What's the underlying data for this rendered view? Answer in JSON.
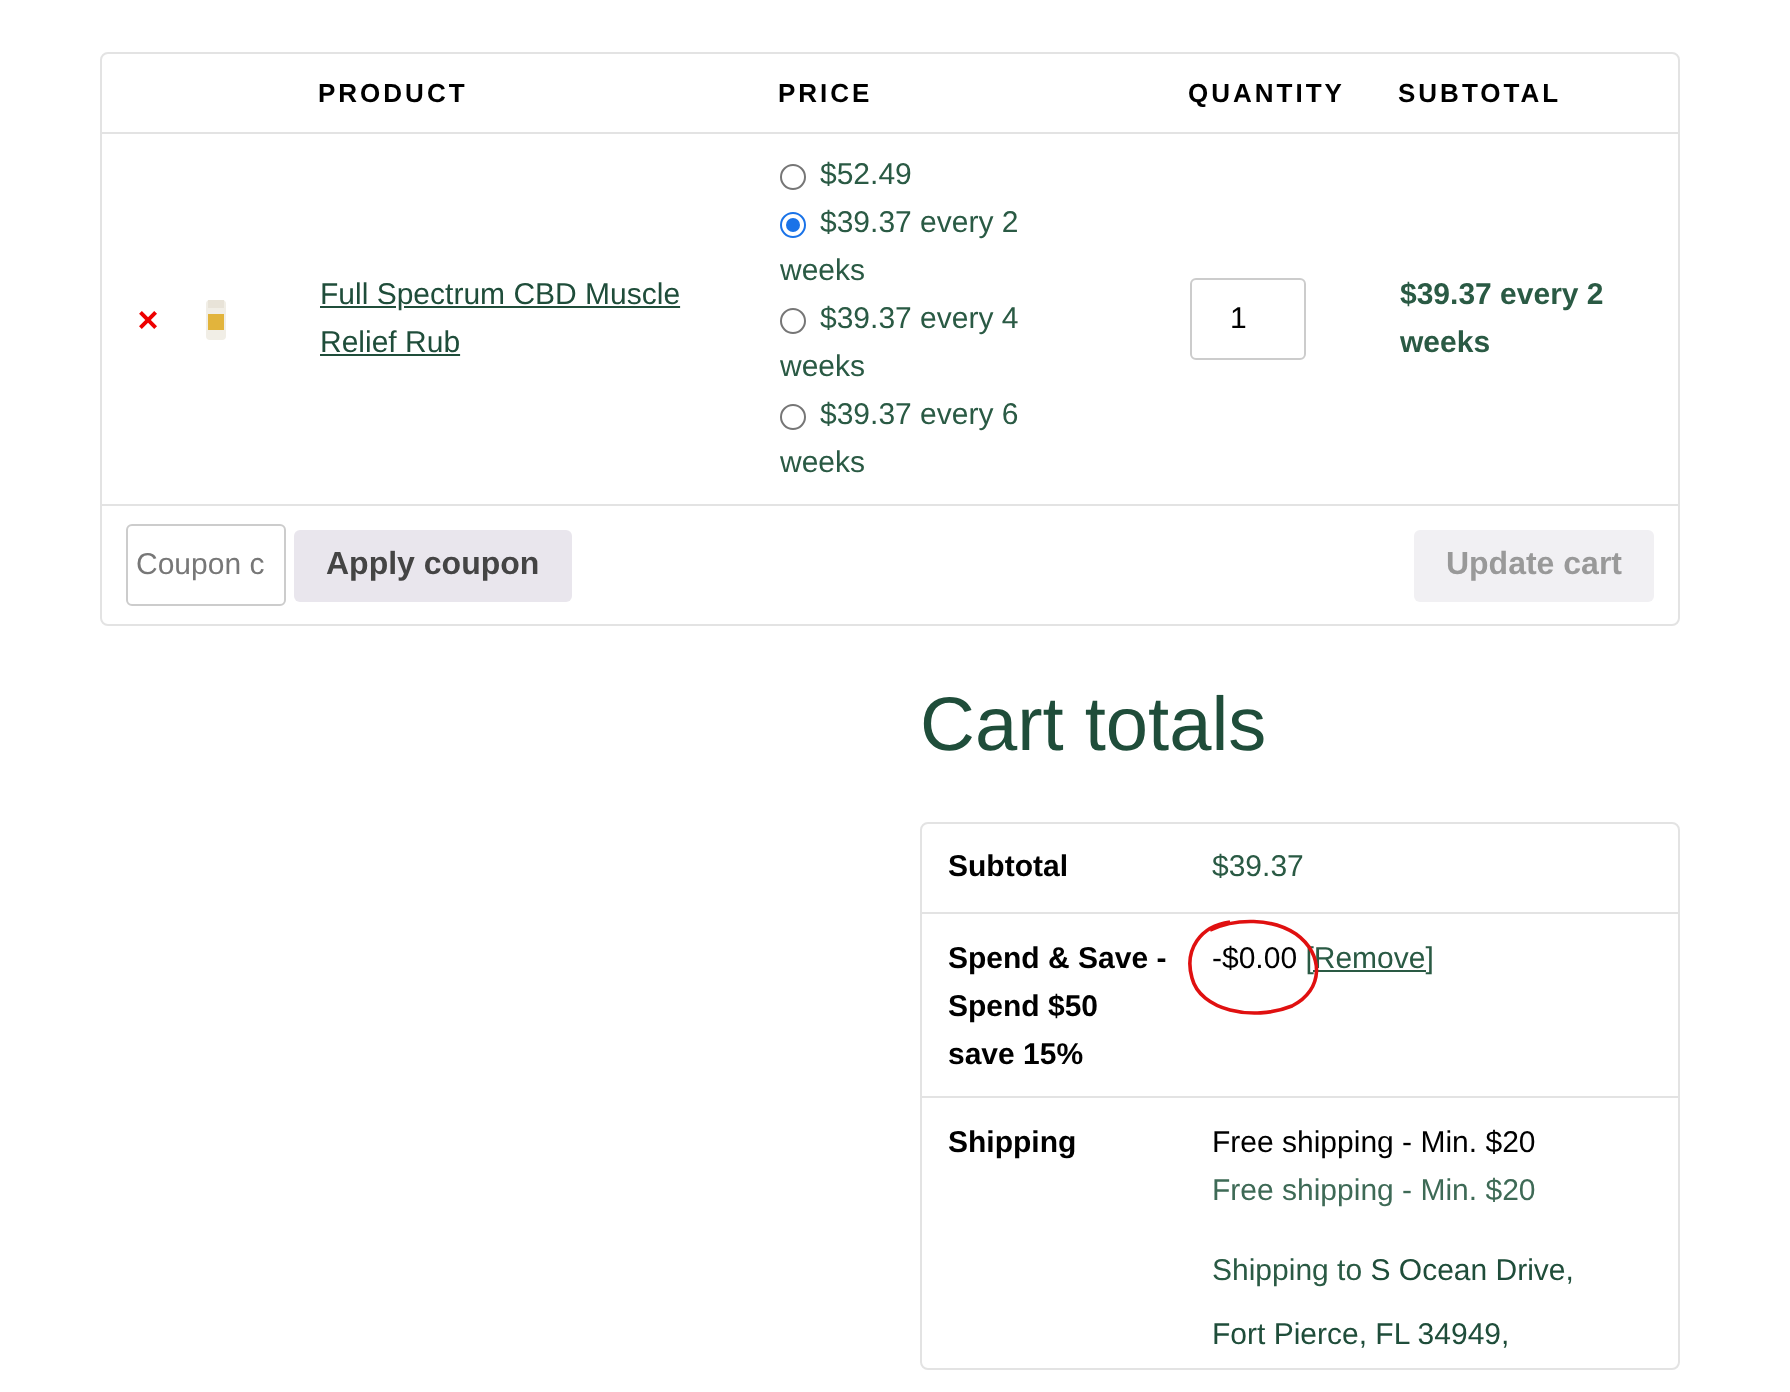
{
  "cart_table": {
    "columns": [
      "PRODUCT",
      "PRICE",
      "QUANTITY",
      "SUBTOTAL"
    ],
    "rows": [
      {
        "remove": "×",
        "product": "Full Spectrum CBD Muscle Relief Rub",
        "price_options": [
          {
            "label": "$52.49",
            "selected": false
          },
          {
            "label": "$39.37 every 2 weeks",
            "selected": true
          },
          {
            "label": "$39.37 every 4 weeks",
            "selected": false
          },
          {
            "label": "$39.37 every 6 weeks",
            "selected": false
          }
        ],
        "quantity": "1",
        "subtotal": "$39.37 every 2 weeks"
      }
    ],
    "coupon": {
      "placeholder": "Coupon c",
      "apply_button": "Apply coupon",
      "update_button": "Update cart",
      "update_disabled": true
    }
  },
  "cart_totals": {
    "title": "Cart totals",
    "subtotal": {
      "label": "Subtotal",
      "value": "$39.37"
    },
    "discount": {
      "label": "Spend & Save - Spend $50 save 15%",
      "value": "-$0.00",
      "remove_link": "[Remove]",
      "circled": true
    },
    "shipping": {
      "label": "Shipping",
      "method": "Free shipping - Min. $20",
      "method_detail": "Free shipping - Min. $20",
      "destination_prefix": "Shipping to",
      "destination": "S Ocean Drive, Fort Pierce, FL 34949,"
    }
  }
}
